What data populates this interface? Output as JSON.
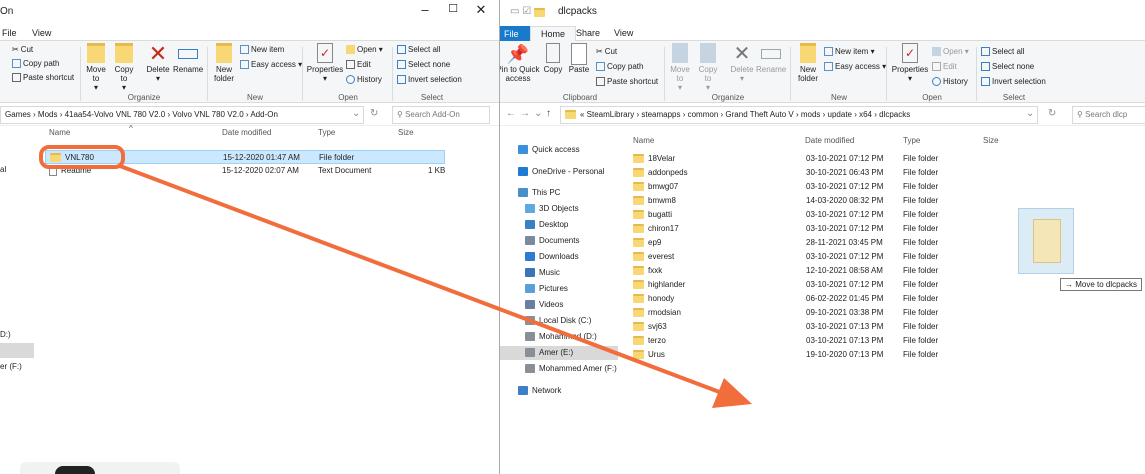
{
  "left": {
    "title": "On",
    "menu": [
      "File",
      "View"
    ],
    "clipboard": {
      "cut": "Cut",
      "copy_path": "Copy path",
      "paste_shortcut": "Paste shortcut"
    },
    "organize": {
      "move_to": "Move to",
      "copy_to": "Copy to",
      "delete": "Delete",
      "rename": "Rename",
      "group": "Organize"
    },
    "new": {
      "new_item": "New item",
      "easy_access": "Easy access",
      "new_folder": "New folder",
      "group": "New"
    },
    "open": {
      "properties": "Properties",
      "open": "Open",
      "edit": "Edit",
      "history": "History",
      "group": "Open"
    },
    "select": {
      "select_all": "Select all",
      "select_none": "Select none",
      "invert": "Invert selection",
      "group": "Select"
    },
    "path": [
      "Games",
      "Mods",
      "41aa54-Volvo VNL 780 V2.0",
      "Volvo VNL 780 V2.0",
      "Add-On"
    ],
    "search_placeholder": "Search Add-On",
    "columns": {
      "name": "Name",
      "date": "Date modified",
      "type": "Type",
      "size": "Size"
    },
    "files": [
      {
        "name": "VNL780",
        "date": "15-12-2020 01:47 AM",
        "type": "File folder",
        "size": ""
      },
      {
        "name": "Readme",
        "date": "15-12-2020 02:07 AM",
        "type": "Text Document",
        "size": "1 KB"
      }
    ],
    "side": [
      "al",
      "D:)",
      "er (F:)"
    ]
  },
  "right": {
    "title": "dlcpacks",
    "menu": {
      "file": "File",
      "home": "Home",
      "share": "Share",
      "view": "View"
    },
    "clipboard": {
      "pin": "Pin to Quick access",
      "copy": "Copy",
      "paste": "Paste",
      "cut": "Cut",
      "copy_path": "Copy path",
      "paste_shortcut": "Paste shortcut",
      "group": "Clipboard"
    },
    "organize": {
      "move_to": "Move to",
      "copy_to": "Copy to",
      "delete": "Delete",
      "rename": "Rename",
      "group": "Organize"
    },
    "new": {
      "new_item": "New item",
      "easy_access": "Easy access",
      "new_folder": "New folder",
      "group": "New"
    },
    "open": {
      "properties": "Properties",
      "open": "Open",
      "edit": "Edit",
      "history": "History",
      "group": "Open"
    },
    "select": {
      "select_all": "Select all",
      "select_none": "Select none",
      "invert": "Invert selection",
      "group": "Select"
    },
    "path": [
      "SteamLibrary",
      "steamapps",
      "common",
      "Grand Theft Auto V",
      "mods",
      "update",
      "x64",
      "dlcpacks"
    ],
    "search_placeholder": "Search dlcp",
    "columns": {
      "name": "Name",
      "date": "Date modified",
      "type": "Type",
      "size": "Size"
    },
    "nav": [
      {
        "label": "Quick access",
        "color": "#3c8fdb"
      },
      {
        "label": "OneDrive - Personal",
        "color": "#1f7ad4"
      },
      {
        "label": "This PC",
        "color": "#4a90c8"
      },
      {
        "label": "3D Objects",
        "color": "#5fa8e0"
      },
      {
        "label": "Desktop",
        "color": "#3b7fc6"
      },
      {
        "label": "Documents",
        "color": "#7a8a9a"
      },
      {
        "label": "Downloads",
        "color": "#2f7bd1"
      },
      {
        "label": "Music",
        "color": "#3b74b8"
      },
      {
        "label": "Pictures",
        "color": "#5aa0d8"
      },
      {
        "label": "Videos",
        "color": "#6a7fa0"
      },
      {
        "label": "Local Disk (C:)",
        "color": "#8a8f96"
      },
      {
        "label": "Mohammed (D:)",
        "color": "#8a8f96"
      },
      {
        "label": "Amer (E:)",
        "color": "#8a8f96"
      },
      {
        "label": "Mohammed Amer (F:)",
        "color": "#8a8f96"
      },
      {
        "label": "Network",
        "color": "#3b7fc6"
      }
    ],
    "files": [
      {
        "name": "18Velar",
        "date": "03-10-2021 07:12 PM",
        "type": "File folder"
      },
      {
        "name": "addonpeds",
        "date": "30-10-2021 06:43 PM",
        "type": "File folder"
      },
      {
        "name": "bmwg07",
        "date": "03-10-2021 07:12 PM",
        "type": "File folder"
      },
      {
        "name": "bmwm8",
        "date": "14-03-2020 08:32 PM",
        "type": "File folder"
      },
      {
        "name": "bugatti",
        "date": "03-10-2021 07:12 PM",
        "type": "File folder"
      },
      {
        "name": "chiron17",
        "date": "03-10-2021 07:12 PM",
        "type": "File folder"
      },
      {
        "name": "ep9",
        "date": "28-11-2021 03:45 PM",
        "type": "File folder"
      },
      {
        "name": "everest",
        "date": "03-10-2021 07:12 PM",
        "type": "File folder"
      },
      {
        "name": "fxxk",
        "date": "12-10-2021 08:58 AM",
        "type": "File folder"
      },
      {
        "name": "highlander",
        "date": "03-10-2021 07:12 PM",
        "type": "File folder"
      },
      {
        "name": "honody",
        "date": "06-02-2022 01:45 PM",
        "type": "File folder"
      },
      {
        "name": "rmodsian",
        "date": "09-10-2021 03:38 PM",
        "type": "File folder"
      },
      {
        "name": "svj63",
        "date": "03-10-2021 07:13 PM",
        "type": "File folder"
      },
      {
        "name": "terzo",
        "date": "03-10-2021 07:13 PM",
        "type": "File folder"
      },
      {
        "name": "Urus",
        "date": "19-10-2020 07:13 PM",
        "type": "File folder"
      }
    ],
    "drag_tooltip": "Move to dlcpacks"
  },
  "colors": {
    "accent": "#1979ca",
    "annotation": "#f26d3c",
    "selection": "#cce8ff"
  }
}
